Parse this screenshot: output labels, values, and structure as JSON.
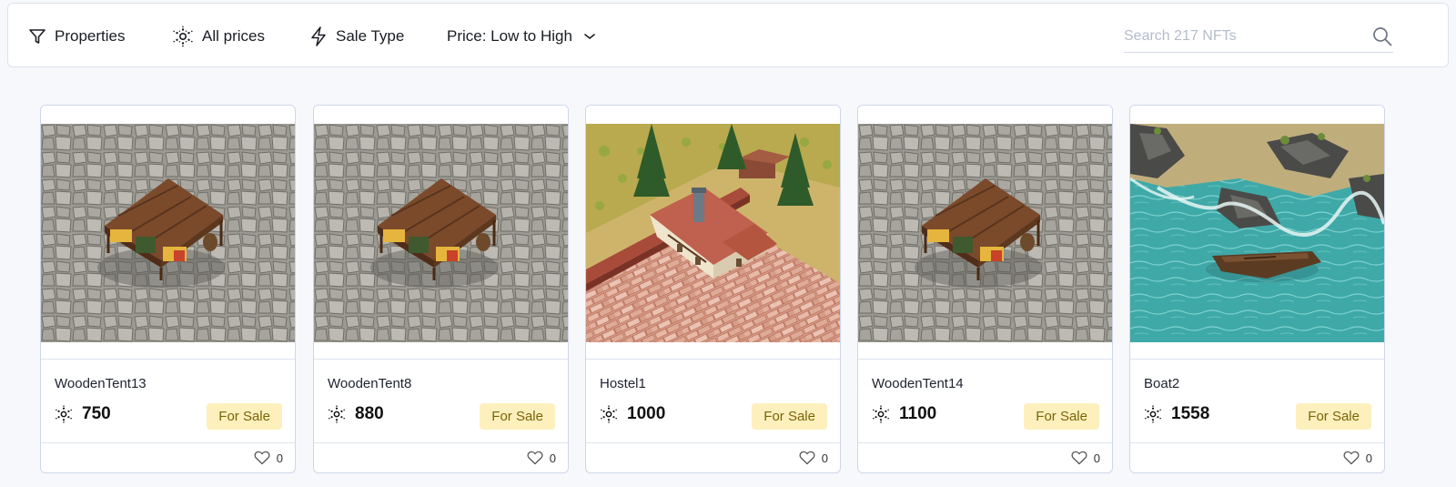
{
  "toolbar": {
    "properties_label": "Properties",
    "prices_label": "All prices",
    "sale_type_label": "Sale Type",
    "sort_label": "Price: Low to High"
  },
  "search": {
    "placeholder": "Search 217 NFTs",
    "value": ""
  },
  "colors": {
    "badge_bg": "#fdf0bd",
    "badge_text": "#7a6408",
    "card_border": "#cdd6ea"
  },
  "cards": [
    {
      "name": "WoodenTent13",
      "price": "750",
      "status": "For Sale",
      "likes": "0",
      "image": "wooden-tent"
    },
    {
      "name": "WoodenTent8",
      "price": "880",
      "status": "For Sale",
      "likes": "0",
      "image": "wooden-tent"
    },
    {
      "name": "Hostel1",
      "price": "1000",
      "status": "For Sale",
      "likes": "0",
      "image": "hostel"
    },
    {
      "name": "WoodenTent14",
      "price": "1100",
      "status": "For Sale",
      "likes": "0",
      "image": "wooden-tent"
    },
    {
      "name": "Boat2",
      "price": "1558",
      "status": "For Sale",
      "likes": "0",
      "image": "boat"
    }
  ]
}
